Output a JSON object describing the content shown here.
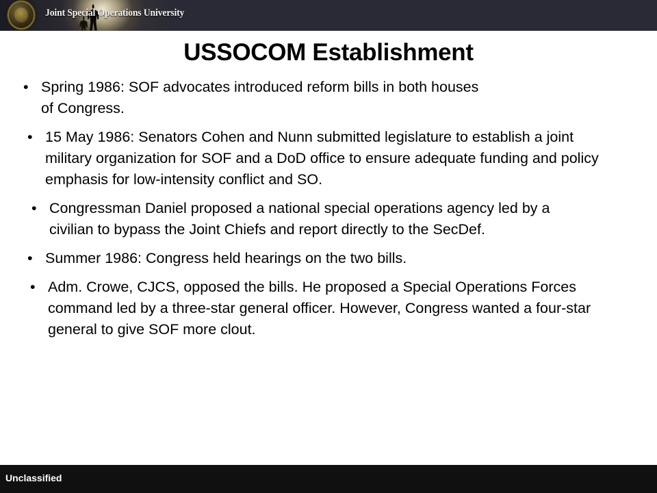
{
  "header": {
    "organization": "Joint Special Operations University",
    "seal_icon": "jsou-seal-icon",
    "soldier_icon": "soldier-silhouette-icon",
    "background_color": "#2a2a36"
  },
  "slide": {
    "title": "USSOCOM Establishment",
    "background_color": "#ffffff",
    "text_color": "#000000",
    "bullet_marker": "•",
    "bullets": [
      "Spring 1986: SOF advocates introduced reform bills in both houses of Congress.",
      "15 May 1986: Senators Cohen and Nunn submitted legislature to establish a joint military organization for SOF and a DoD office to ensure adequate funding and policy emphasis for low-intensity conflict and SO.",
      "Congressman Daniel proposed a national special operations agency led by a civilian to bypass the Joint Chiefs and report directly to the SecDef.",
      "Summer 1986: Congress held hearings on the two bills.",
      "Adm. Crowe, CJCS, opposed the bills. He proposed a Special Operations Forces command led by a three-star general officer. However, Congress wanted a four-star general to give SOF more clout."
    ]
  },
  "footer": {
    "classification": "Unclassified",
    "background_color": "#101010",
    "text_color": "#ffffff"
  }
}
